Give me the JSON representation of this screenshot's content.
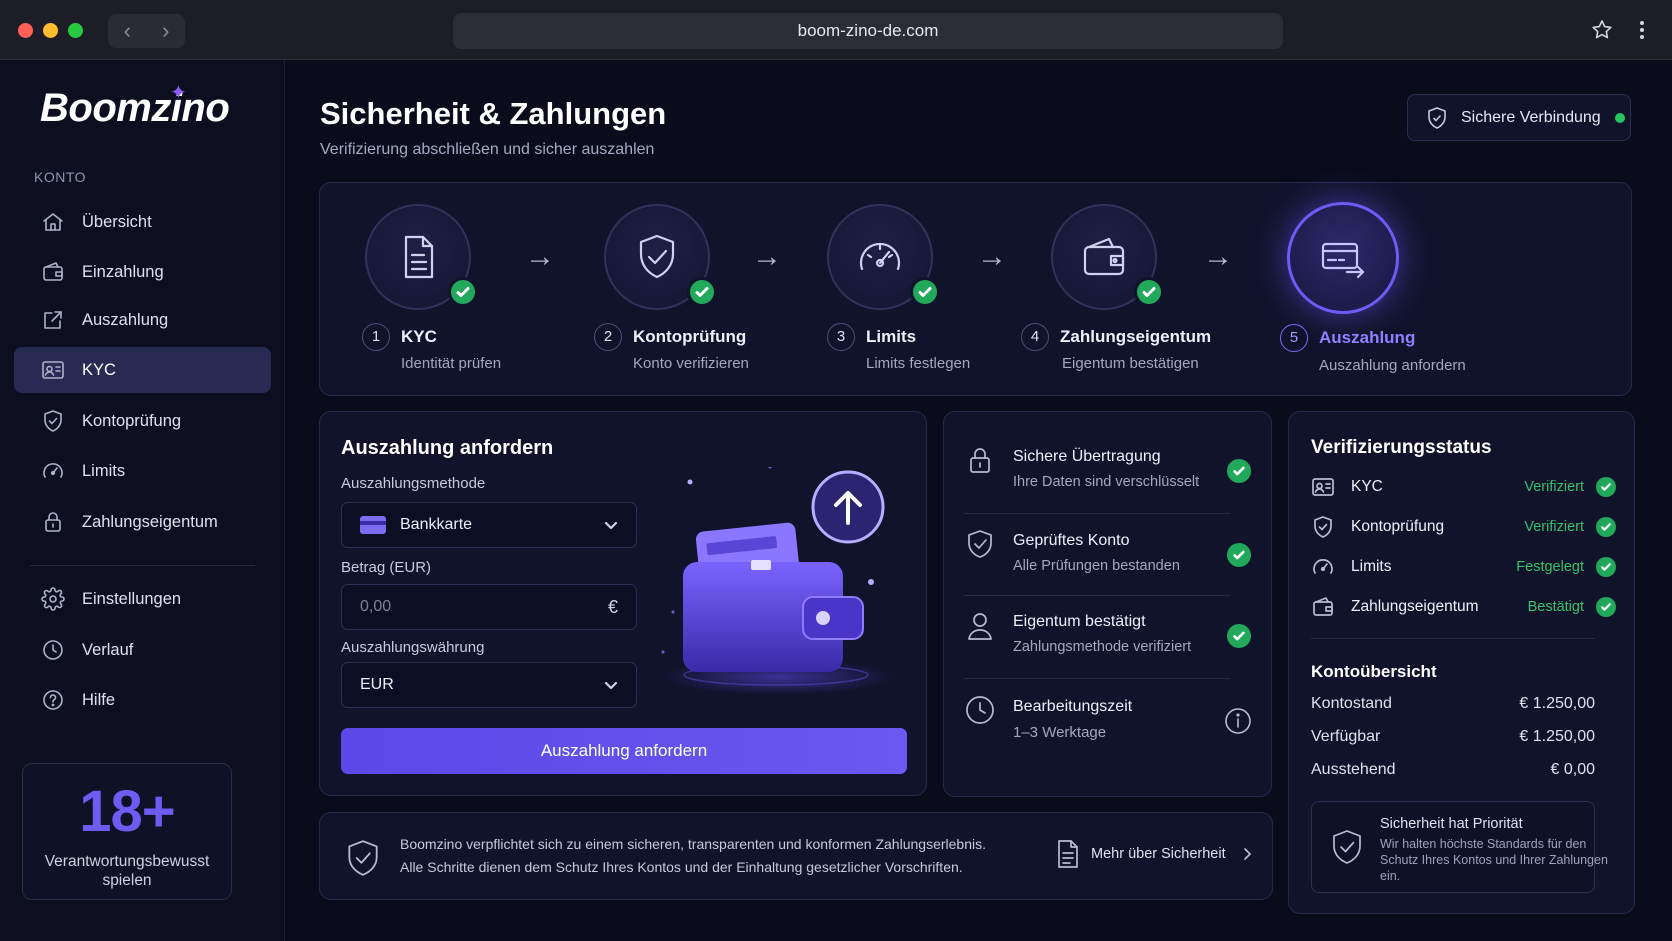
{
  "browser": {
    "url": "boom-zino-de.com",
    "back_glyph": "‹",
    "forward_glyph": "›",
    "star_icon": "star-icon",
    "menu_icon": "more-vertical-icon"
  },
  "sidebar": {
    "logo": "Boomzino",
    "section_label": "KONTO",
    "items": [
      {
        "label": "Übersicht",
        "icon": "home-icon"
      },
      {
        "label": "Einzahlung",
        "icon": "wallet-icon"
      },
      {
        "label": "Auszahlung",
        "icon": "external-arrow-icon"
      },
      {
        "label": "KYC",
        "icon": "id-card-icon",
        "active": true
      },
      {
        "label": "Kontoprüfung",
        "icon": "shield-check-icon"
      },
      {
        "label": "Limits",
        "icon": "gauge-icon"
      },
      {
        "label": "Zahlungseigentum",
        "icon": "lock-icon"
      },
      {
        "label": "Einstellungen",
        "icon": "gear-icon"
      },
      {
        "label": "Verlauf",
        "icon": "clock-icon"
      },
      {
        "label": "Hilfe",
        "icon": "help-icon"
      }
    ],
    "age_badge": {
      "number": "18+",
      "text": "Verantwortungsbewusst spielen"
    }
  },
  "header": {
    "title": "Sicherheit & Zahlungen",
    "subtitle": "Verifizierung abschließen und sicher auszahlen",
    "secure_badge": "Sichere Verbindung"
  },
  "steps": [
    {
      "num": "1",
      "label": "KYC",
      "desc": "Identität prüfen",
      "icon": "document-icon",
      "done": true
    },
    {
      "num": "2",
      "label": "Kontoprüfung",
      "desc": "Konto verifizieren",
      "icon": "shield-check-icon",
      "done": true
    },
    {
      "num": "3",
      "label": "Limits",
      "desc": "Limits festlegen",
      "icon": "gauge-icon",
      "done": true
    },
    {
      "num": "4",
      "label": "Zahlungseigentum",
      "desc": "Eigentum bestätigen",
      "icon": "wallet-icon",
      "done": true
    },
    {
      "num": "5",
      "label": "Auszahlung",
      "desc": "Auszahlung anfordern",
      "icon": "card-transfer-icon",
      "done": false,
      "active": true
    }
  ],
  "step_arrow": "→",
  "withdraw_form": {
    "title": "Auszahlung anfordern",
    "method_label": "Auszahlungsmethode",
    "method_value": "Bankkarte",
    "amount_label": "Betrag (EUR)",
    "amount_placeholder": "0,00",
    "amount_symbol": "€",
    "currency_label": "Auszahlungswährung",
    "currency_value": "EUR",
    "submit_label": "Auszahlung anfordern"
  },
  "security_list": [
    {
      "title": "Sichere Übertragung",
      "desc": "Ihre Daten sind verschlüsselt",
      "icon": "lock-icon",
      "status": "check"
    },
    {
      "title": "Geprüftes Konto",
      "desc": "Alle Prüfungen bestanden",
      "icon": "shield-check-icon",
      "status": "check"
    },
    {
      "title": "Eigentum bestätigt",
      "desc": "Zahlungsmethode verifiziert",
      "icon": "user-icon",
      "status": "check"
    },
    {
      "title": "Bearbeitungszeit",
      "desc": "1–3 Werktage",
      "icon": "clock-icon",
      "status": "info"
    }
  ],
  "verification": {
    "title": "Verifizierungsstatus",
    "rows": [
      {
        "name": "KYC",
        "value": "Verifiziert",
        "icon": "id-card-icon"
      },
      {
        "name": "Kontoprüfung",
        "value": "Verifiziert",
        "icon": "shield-check-icon"
      },
      {
        "name": "Limits",
        "value": "Festgelegt",
        "icon": "gauge-icon"
      },
      {
        "name": "Zahlungseigentum",
        "value": "Bestätigt",
        "icon": "wallet-icon"
      }
    ],
    "overview_title": "Kontoübersicht",
    "overview": [
      {
        "label": "Kontostand",
        "value": "€ 1.250,00"
      },
      {
        "label": "Verfügbar",
        "value": "€ 1.250,00"
      },
      {
        "label": "Ausstehend",
        "value": "€ 0,00"
      }
    ],
    "notice_title": "Sicherheit hat Priorität",
    "notice_text": "Wir halten höchste Standards für den Schutz Ihres Kontos und Ihrer Zahlungen ein."
  },
  "banner": {
    "line1": "Boomzino verpflichtet sich zu einem sicheren, transparenten und konformen Zahlungserlebnis.",
    "line2": "Alle Schritte dienen dem Schutz Ihres Kontos und der Einhaltung gesetzlicher Vorschriften.",
    "link": "Mehr über Sicherheit"
  },
  "colors": {
    "accent": "#6b5cf5",
    "success": "#22a85a",
    "background": "#0a0c1c",
    "card": "#11132b"
  }
}
